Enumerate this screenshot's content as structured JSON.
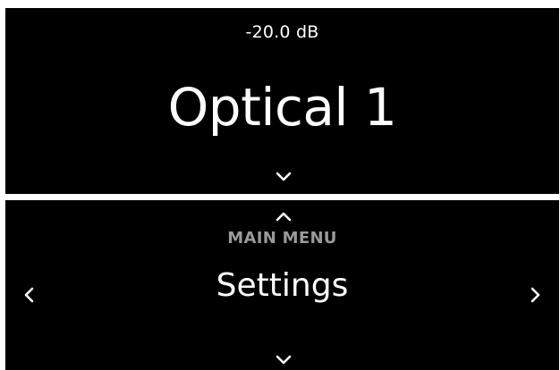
{
  "top_screen": {
    "volume": "-20.0 dB",
    "source": "Optical 1",
    "icons": {
      "down": "chevron-down-icon"
    }
  },
  "bottom_screen": {
    "menu_label": "MAIN MENU",
    "menu_item": "Settings",
    "icons": {
      "up": "chevron-up-icon",
      "down": "chevron-down-icon",
      "left": "chevron-left-icon",
      "right": "chevron-right-icon"
    }
  },
  "colors": {
    "screen_bg": "#000000",
    "text": "#ffffff",
    "label_gray": "#9a9a9a",
    "frame": "#ffffff"
  }
}
